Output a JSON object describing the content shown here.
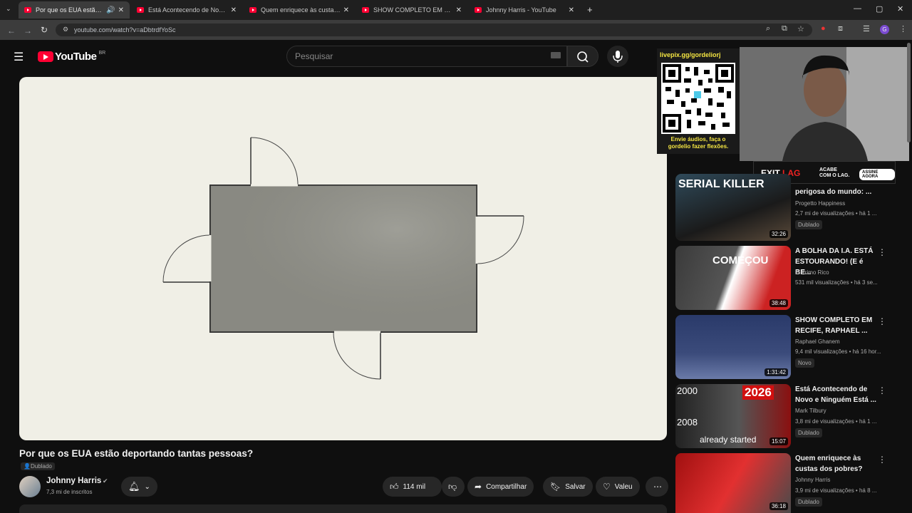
{
  "browser": {
    "tabs": [
      {
        "title": "Por que os EUA estão depo",
        "active": true
      },
      {
        "title": "Está Acontecendo de Novo e N"
      },
      {
        "title": "Quem enriquece às custas dos"
      },
      {
        "title": "SHOW COMPLETO EM RECIFE,"
      },
      {
        "title": "Johnny Harris - YouTube"
      }
    ],
    "url": "youtube.com/watch?v=aDbtrdfYoSc"
  },
  "header": {
    "logo_text": "YouTube",
    "region": "BR",
    "search_placeholder": "Pesquisar"
  },
  "video": {
    "title": "Por que os EUA estão deportando tantas pessoas?",
    "dubbed_badge": "Dublado",
    "channel": "Johnny Harris",
    "subscribers": "7,3 mi de inscritos",
    "likes": "114 mil",
    "share_label": "Compartilhar",
    "save_label": "Salvar",
    "thanks_label": "Valeu"
  },
  "overlay": {
    "qr_url": "livepix.gg/gordeliorj",
    "qr_caption_1": "Envie áudios, faça o",
    "qr_caption_2": "gordelio fazer flexões.",
    "banner_exit": "EXIT",
    "banner_lag": "LAG",
    "banner_cta_1": "ACABE",
    "banner_cta_2": "COM O LAG.",
    "banner_button": "ASSINE AGORA"
  },
  "sidebar": [
    {
      "title": "perigosa do mundo: ...",
      "channel": "Progetto Happiness",
      "meta": "2,7 mi de visualizações • há 1 ...",
      "badge": "Dublado",
      "duration": "32:26",
      "thumb_text": "SERIAL KILLER"
    },
    {
      "title": "A BOLHA DA I.A. ESTÁ ESTOURANDO! (E é BE...",
      "channel": "O Primo Rico",
      "meta": "531 mil visualizações • há 3 se...",
      "duration": "38:48",
      "thumb_text": "COMEÇOU"
    },
    {
      "title": "SHOW COMPLETO EM RECIFE, RAPHAEL ...",
      "channel": "Raphael Ghanem",
      "meta": "9,4 mil visualizações • há 16 hor...",
      "badge": "Novo",
      "duration": "1:31:42"
    },
    {
      "title": "Está Acontecendo de Novo e Ninguém Está ...",
      "channel": "Mark Tilbury",
      "meta": "3,8 mi de visualizações • há 1 ...",
      "badge": "Dublado",
      "duration": "15:07",
      "thumb_text_1": "2000",
      "thumb_text_2": "2008",
      "thumb_text_3": "2026",
      "thumb_text_4": "already started"
    },
    {
      "title": "Quem enriquece às custas dos pobres?",
      "channel": "Johnny Harris",
      "meta": "3,9 mi de visualizações • há 8 ...",
      "badge": "Dublado",
      "duration": "36:18"
    }
  ]
}
